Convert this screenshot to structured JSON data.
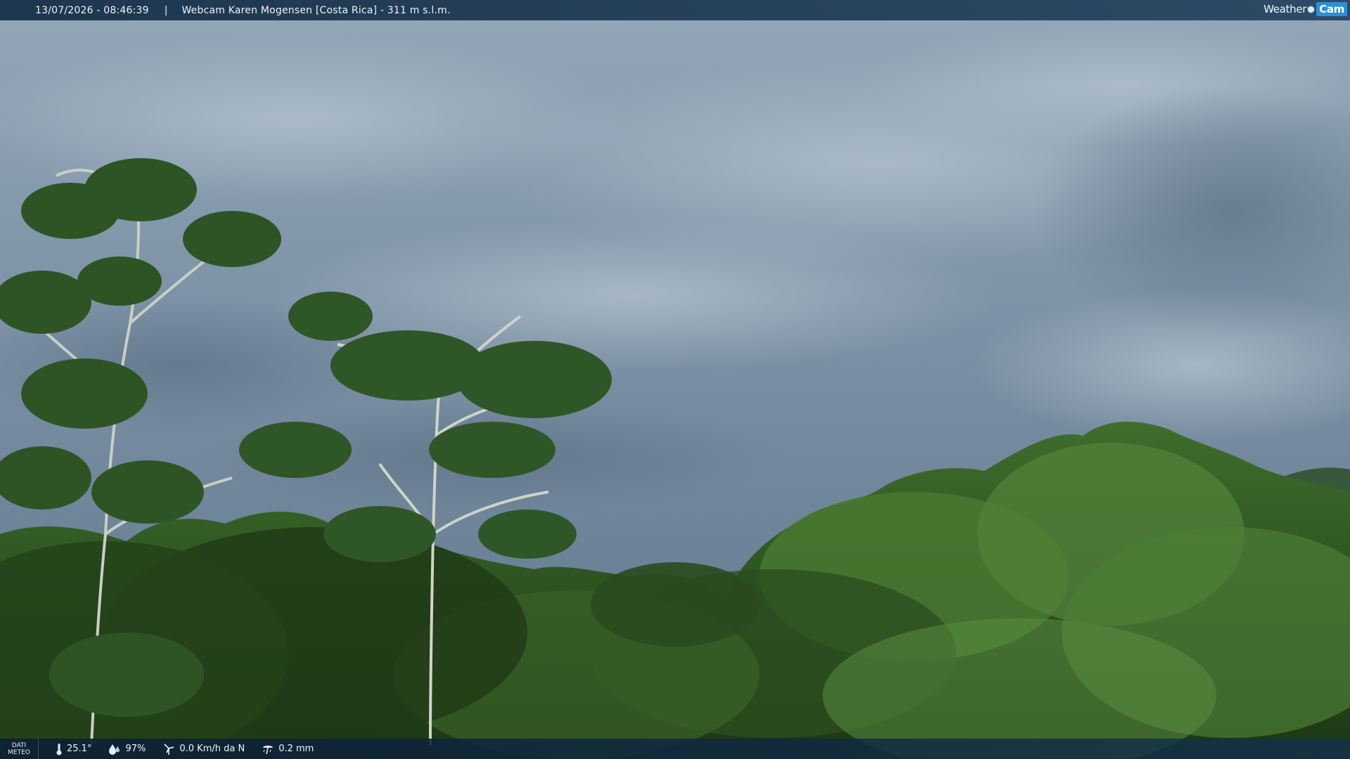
{
  "header": {
    "timestamp": "13/07/2026 - 08:46:39",
    "separator": "|",
    "title": "Webcam Karen Mogensen [Costa Rica]  - 311 m s.l.m."
  },
  "brand": {
    "weather": "Weather",
    "cam": "Cam"
  },
  "footer": {
    "label_line1": "DATI",
    "label_line2": "METEO",
    "temperature": "25.1°",
    "humidity": "97%",
    "wind": "0.0 Km/h da N",
    "rain": "0.2 mm"
  },
  "icons": {
    "temperature": "thermometer-icon",
    "humidity": "humidity-drop-icon",
    "wind": "wind-turbine-icon",
    "rain": "rain-gauge-icon"
  },
  "colors": {
    "sky": "#7f93a6",
    "forest": "#2f5a22",
    "bar": "#14304c",
    "brand_accent": "#2d8fd6"
  }
}
